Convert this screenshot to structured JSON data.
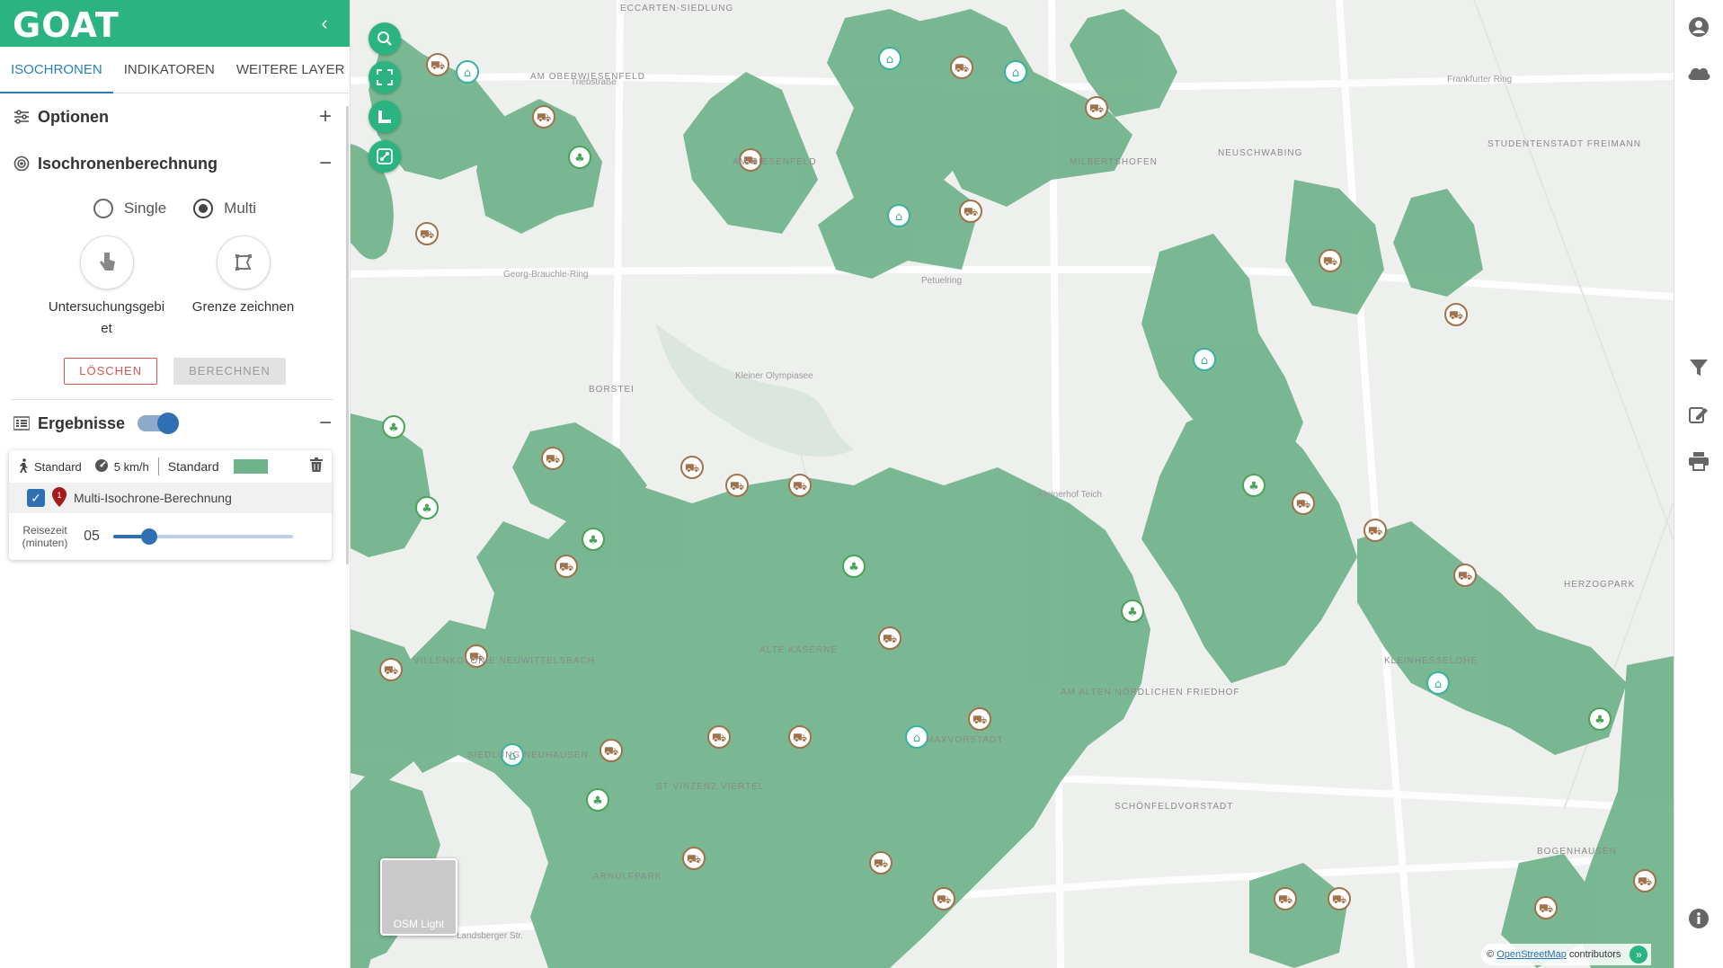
{
  "app": {
    "logo": "GOAT",
    "collapse_icon": "chevron-left-icon"
  },
  "tabs": [
    {
      "label": "ISOCHRONEN",
      "active": true
    },
    {
      "label": "INDIKATOREN",
      "active": false
    },
    {
      "label": "WEITERE LAYER",
      "active": false
    }
  ],
  "options": {
    "title": "Optionen",
    "toggle": "+"
  },
  "isochrone": {
    "title": "Isochronenberechnung",
    "toggle": "−",
    "mode_single": "Single",
    "mode_multi": "Multi",
    "selected_mode": "Multi",
    "tool_area": "Untersuchungsgebiet",
    "tool_draw": "Grenze zeichnen",
    "clear_button": "LÖSCHEN",
    "calc_button": "BERECHNEN"
  },
  "results": {
    "title": "Ergebnisse",
    "toggle": "−",
    "visible": true,
    "card": {
      "mode": "Standard",
      "speed": "5 km/h",
      "style": "Standard",
      "swatch_color": "#6fb38a",
      "marker_number": "1",
      "name": "Multi-Isochrone-Berechnung",
      "travel_label": "Reisezeit (minuten)",
      "travel_value": "05",
      "travel_fraction": 0.2
    }
  },
  "map": {
    "basemap_label": "OSM Light",
    "attribution_prefix": "©",
    "attribution_link": "OpenStreetMap",
    "attribution_suffix": "contributors",
    "labels": [
      "ECCARTEN-SIEDLUNG",
      "AM OBERWIESENFELD",
      "AM RIESENFELD",
      "MILBERTSHOFEN",
      "NEUSCHWABING",
      "STUDENTENSTADT FREIMANN",
      "BORSTEI",
      "HERZOGPARK",
      "ALTE KASERNE",
      "VILLENKOLONIE NEUWITTELSBACH",
      "KLEINHESSELOHE",
      "AM ALTEN NÖRDLICHEN FRIEDHOF",
      "SIEDLUNG NEUHAUSEN",
      "ST VINZENZ VIERTEL",
      "SCHÖNFELDVORSTADT",
      "ARNULFPARK",
      "BOGENHAUSEN",
      "MAXVORSTADT"
    ],
    "streets": [
      "Triebstraße",
      "Frankfurter Ring",
      "Georg-Brauchle-Ring",
      "Petuelring",
      "Kleiner Olympiasee",
      "Kleinerhof Teich",
      "Landsberger Str."
    ]
  },
  "map_tools": [
    "search-icon",
    "fullscreen-icon",
    "measure-icon",
    "routing-icon"
  ],
  "right_tools": [
    "account-icon",
    "cloud-icon",
    "filter-icon",
    "edit-icon",
    "print-icon",
    "info-icon"
  ]
}
